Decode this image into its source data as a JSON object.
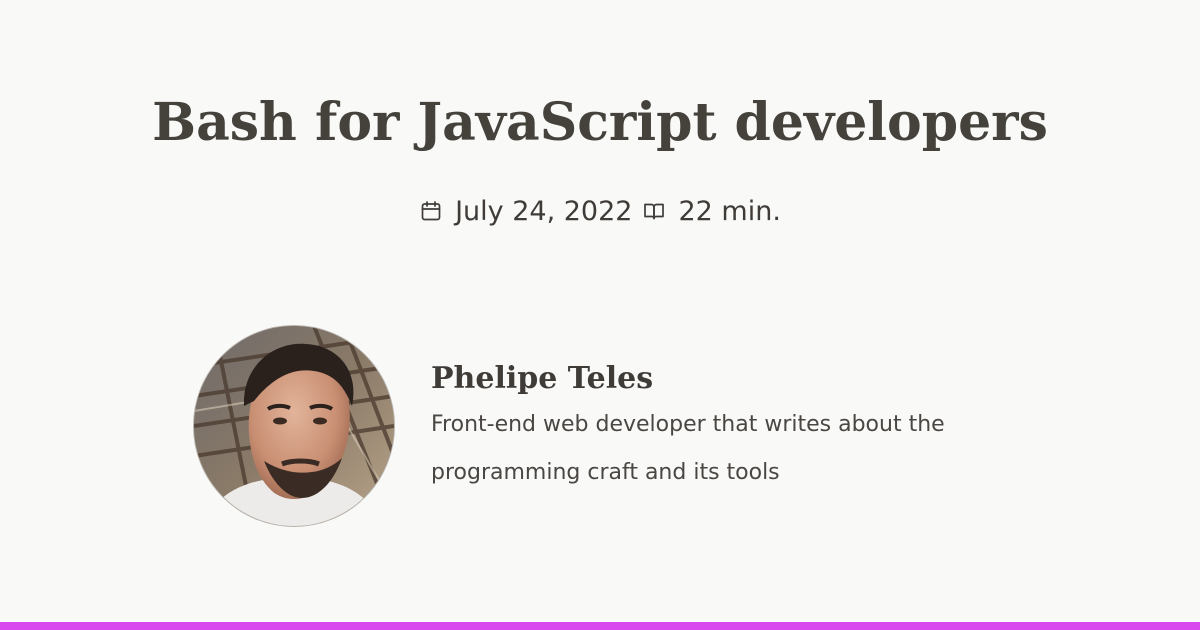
{
  "post": {
    "title": "Bash for JavaScript developers",
    "date": "July 24, 2022",
    "reading_time": "22 min."
  },
  "author": {
    "name": "Phelipe Teles",
    "bio": "Front-end web developer that writes about the programming craft and its tools"
  },
  "icons": {
    "date": "calendar-icon",
    "reading_time": "book-open-icon"
  },
  "colors": {
    "background": "#f9f9f8",
    "text": "#3e3b37",
    "accent_bar": "#d946ef"
  }
}
